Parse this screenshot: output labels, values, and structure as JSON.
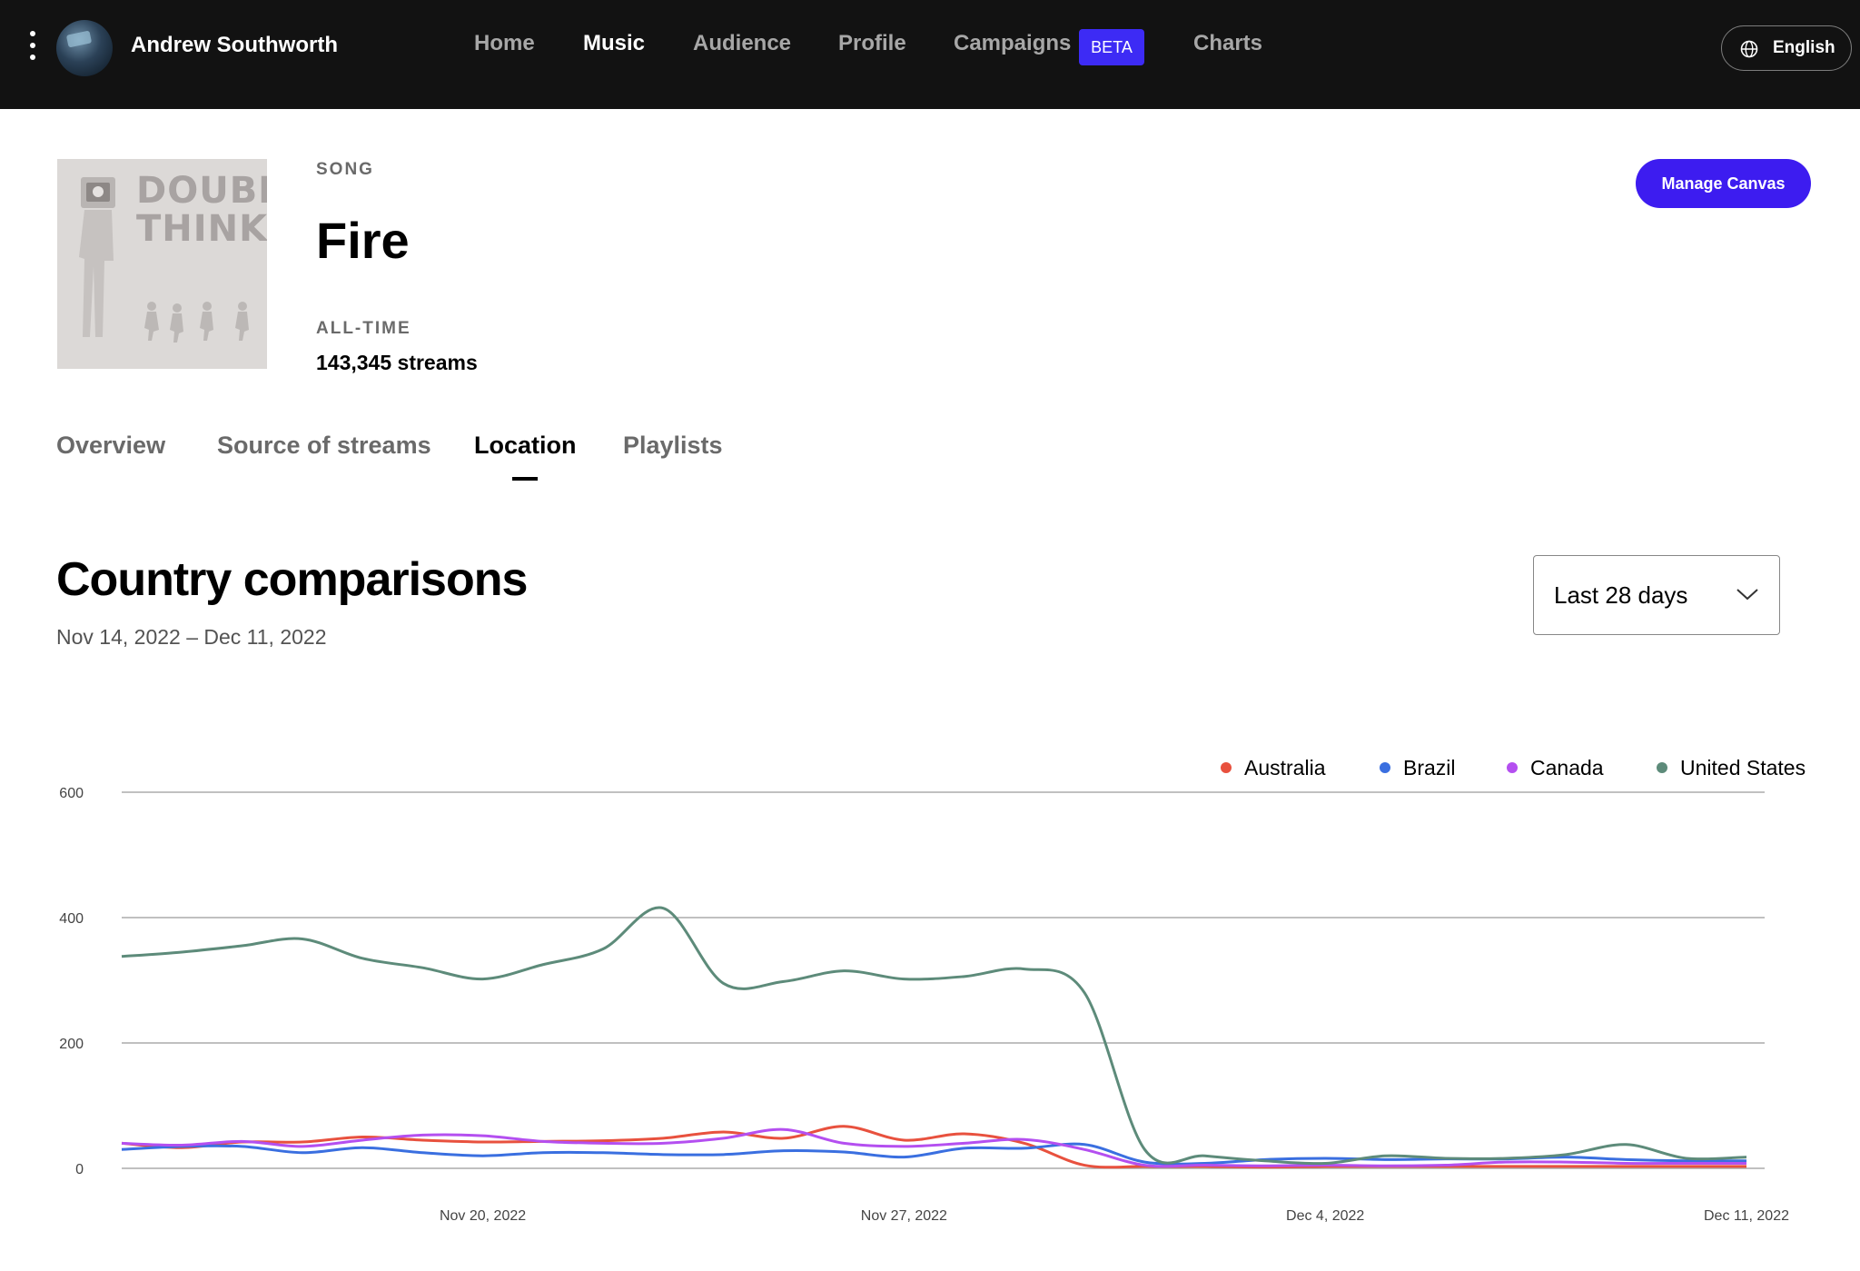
{
  "header": {
    "artist_name": "Andrew Southworth",
    "nav": [
      "Home",
      "Music",
      "Audience",
      "Profile",
      "Campaigns",
      "Charts"
    ],
    "active_nav": "Music",
    "beta_badge": "BETA",
    "language": "English"
  },
  "song": {
    "kind_label": "SONG",
    "title": "Fire",
    "alltime_label": "ALL-TIME",
    "streams": "143,345 streams",
    "cover_text": "DOUBLE THINK",
    "manage_button": "Manage Canvas"
  },
  "tabs": [
    "Overview",
    "Source of streams",
    "Location",
    "Playlists"
  ],
  "active_tab": "Location",
  "section": {
    "title": "Country comparisons",
    "date_range": "Nov 14, 2022 – Dec 11, 2022",
    "period_select": "Last 28 days"
  },
  "chart_data": {
    "type": "line",
    "x": [
      "Nov 14, 2022",
      "Nov 15, 2022",
      "Nov 16, 2022",
      "Nov 17, 2022",
      "Nov 18, 2022",
      "Nov 19, 2022",
      "Nov 20, 2022",
      "Nov 21, 2022",
      "Nov 22, 2022",
      "Nov 23, 2022",
      "Nov 24, 2022",
      "Nov 25, 2022",
      "Nov 26, 2022",
      "Nov 27, 2022",
      "Nov 28, 2022",
      "Nov 29, 2022",
      "Nov 30, 2022",
      "Dec 1, 2022",
      "Dec 2, 2022",
      "Dec 3, 2022",
      "Dec 4, 2022",
      "Dec 5, 2022",
      "Dec 6, 2022",
      "Dec 7, 2022",
      "Dec 8, 2022",
      "Dec 9, 2022",
      "Dec 10, 2022",
      "Dec 11, 2022"
    ],
    "x_tick_labels": [
      "Nov 20, 2022",
      "Nov 27, 2022",
      "Dec 4, 2022",
      "Dec 11, 2022"
    ],
    "y_ticks": [
      0,
      200,
      400,
      600
    ],
    "ylim": [
      0,
      600
    ],
    "legend_position": "top-right",
    "grid": true,
    "series": [
      {
        "name": "Australia",
        "color": "#e8513e",
        "values": [
          40,
          33,
          42,
          42,
          50,
          45,
          42,
          43,
          44,
          48,
          58,
          48,
          67,
          45,
          55,
          40,
          5,
          3,
          3,
          2,
          3,
          3,
          3,
          3,
          3,
          3,
          3,
          3
        ]
      },
      {
        "name": "Brazil",
        "color": "#3a6fe0",
        "values": [
          30,
          35,
          35,
          25,
          33,
          25,
          20,
          25,
          25,
          22,
          22,
          28,
          26,
          18,
          32,
          32,
          38,
          10,
          8,
          14,
          16,
          14,
          15,
          15,
          18,
          14,
          12,
          12
        ]
      },
      {
        "name": "Canada",
        "color": "#b44ff0",
        "values": [
          40,
          37,
          43,
          35,
          45,
          53,
          52,
          43,
          40,
          40,
          48,
          62,
          40,
          35,
          40,
          46,
          30,
          5,
          5,
          4,
          5,
          4,
          5,
          10,
          10,
          8,
          8,
          8
        ]
      },
      {
        "name": "United States",
        "color": "#5d8b7a",
        "values": [
          338,
          345,
          355,
          366,
          335,
          320,
          302,
          325,
          350,
          415,
          295,
          298,
          315,
          302,
          306,
          318,
          280,
          30,
          20,
          12,
          8,
          20,
          16,
          16,
          22,
          38,
          16,
          18
        ]
      }
    ]
  }
}
